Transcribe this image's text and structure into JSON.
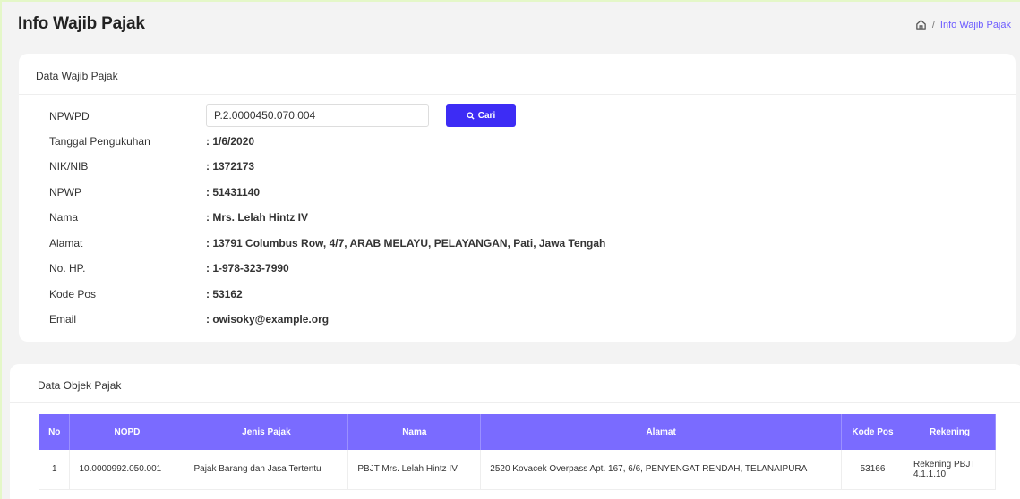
{
  "header": {
    "title": "Info Wajib Pajak",
    "breadcrumb_sep": "/",
    "breadcrumb_current": "Info Wajib Pajak"
  },
  "wajib_pajak": {
    "title": "Data Wajib Pajak",
    "npwpd_label": "NPWPD",
    "npwpd_value": "P.2.0000450.070.004",
    "search_button": "Cari",
    "fields": [
      {
        "label": "Tanggal Pengukuhan",
        "value": ": 1/6/2020"
      },
      {
        "label": "NIK/NIB",
        "value": ": 1372173"
      },
      {
        "label": "NPWP",
        "value": ": 51431140"
      },
      {
        "label": "Nama",
        "value": ": Mrs. Lelah Hintz IV"
      },
      {
        "label": "Alamat",
        "value": ": 13791 Columbus Row, 4/7, ARAB MELAYU, PELAYANGAN, Pati, Jawa Tengah"
      },
      {
        "label": "No. HP.",
        "value": ": 1-978-323-7990"
      },
      {
        "label": "Kode Pos",
        "value": ": 53162"
      },
      {
        "label": "Email",
        "value": ": owisoky@example.org"
      }
    ]
  },
  "objek_pajak": {
    "title": "Data Objek Pajak",
    "columns": [
      "No",
      "NOPD",
      "Jenis Pajak",
      "Nama",
      "Alamat",
      "Kode Pos",
      "Rekening"
    ],
    "rows": [
      {
        "no": "1",
        "nopd": "10.0000992.050.001",
        "jenis": "Pajak Barang dan Jasa Tertentu",
        "nama": "PBJT Mrs. Lelah Hintz IV",
        "alamat": "2520 Kovacek Overpass Apt. 167, 6/6, PENYENGAT RENDAH, TELANAIPURA",
        "kode_pos": "53166",
        "rekening_line1": "Rekening PBJT",
        "rekening_line2": "4.1.1.10"
      }
    ]
  },
  "colors": {
    "accent": "#3d2cf5",
    "table_header": "#7a6bff",
    "breadcrumb": "#6d5cff"
  },
  "icons": {
    "home": "home-icon",
    "search": "search-icon"
  }
}
